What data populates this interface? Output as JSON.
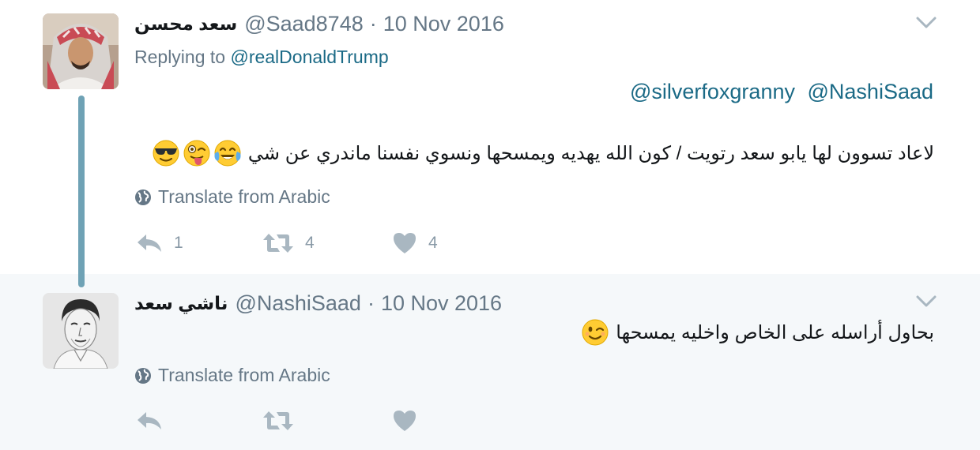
{
  "colors": {
    "link": "#1b6a86",
    "muted": "#657786",
    "icon": "#a9b7c1",
    "thread_line": "#6fa2b5",
    "reply_bg": "#f5f8fa"
  },
  "tweets": [
    {
      "author_name": "سعد محسن",
      "handle": "@Saad8748",
      "separator": "·",
      "date": "10 Nov 2016",
      "replying_prefix": "Replying to",
      "replying_to": "@realDonaldTrump",
      "mentions": [
        "@silverfoxgranny",
        "@NashiSaad"
      ],
      "text": "لاعاد تسوون لها يابو سعد رتويت / كون الله يهديه ويمسحها ونسوي نفسنا ماندري عن شي",
      "emojis": [
        "face-with-tears-of-joy-icon",
        "winking-face-with-tongue-icon",
        "smiling-face-with-sunglasses-icon"
      ],
      "translate_label": "Translate from Arabic",
      "reply_count": "1",
      "retweet_count": "4",
      "like_count": "4"
    },
    {
      "author_name": "ناشي سعد",
      "handle": "@NashiSaad",
      "separator": "·",
      "date": "10 Nov 2016",
      "text": "بحاول أراسله على الخاص واخليه يمسحها",
      "emojis": [
        "winking-face-icon"
      ],
      "translate_label": "Translate from Arabic"
    }
  ]
}
